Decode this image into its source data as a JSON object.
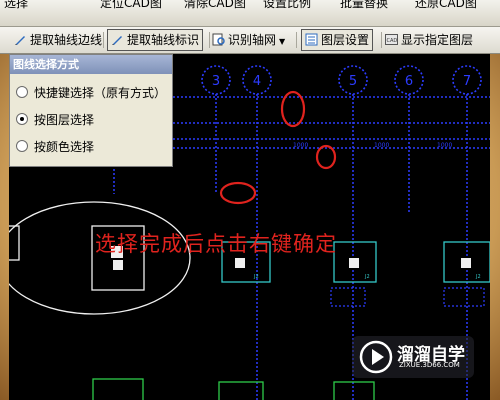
{
  "toolbar_top": {
    "items": [
      "选择",
      "定位CAD图",
      "清除CAD图",
      "设置比例",
      "批量替换",
      "还原CAD图"
    ]
  },
  "toolbar": {
    "extract_edge_label": "提取轴线边线",
    "extract_label_label": "提取轴线标识",
    "identify_grid_label": "识别轴网",
    "layer_settings_label": "图层设置",
    "show_layer_label": "显示指定图层"
  },
  "panel": {
    "title": "图线选择方式",
    "options": [
      {
        "label": "快捷键选择（原有方式）",
        "selected": false
      },
      {
        "label": "按图层选择",
        "selected": true
      },
      {
        "label": "按颜色选择",
        "selected": false
      }
    ]
  },
  "cad": {
    "axis_labels": [
      "3",
      "4",
      "5",
      "6",
      "7"
    ],
    "dimension_texts": [
      "1000",
      "1000",
      "1000"
    ],
    "column_tags": [
      "J2",
      "J2",
      "J2"
    ],
    "instruction": "选择完成后点击右键确定"
  },
  "watermark": {
    "name": "溜溜自学",
    "url": "ZIXUE.3D66.COM"
  },
  "colors": {
    "accent_blue": "#2c3cff",
    "annotation_red": "#e0231e",
    "column_cyan": "#34c8c8"
  }
}
